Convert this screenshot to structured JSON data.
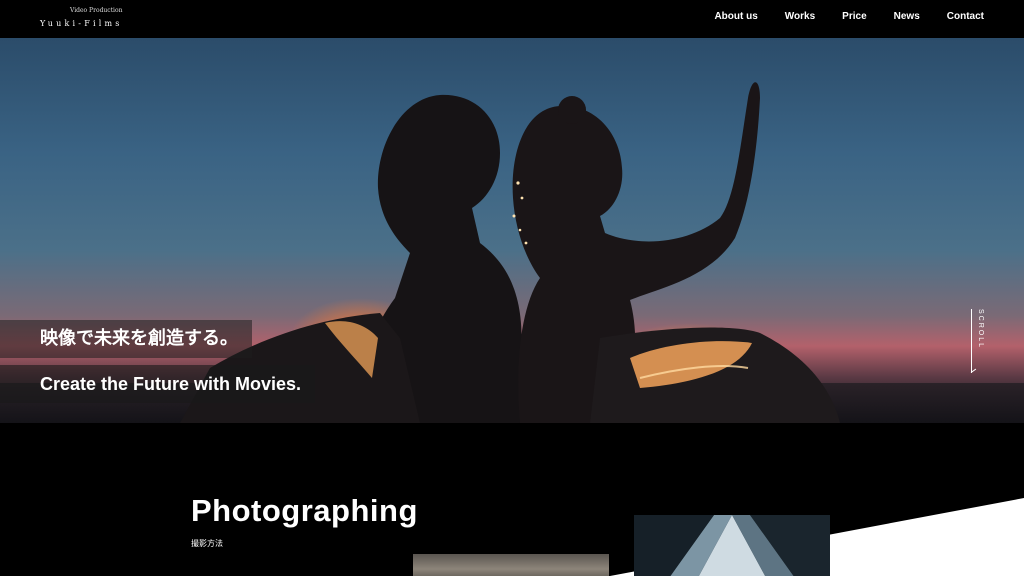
{
  "header": {
    "logo_sub": "Video Production",
    "logo_main": "Yuuki-Films",
    "nav": [
      "About us",
      "Works",
      "Price",
      "News",
      "Contact"
    ]
  },
  "hero": {
    "tagline_jp": "映像で未来を創造する。",
    "tagline_en": "Create the Future with Movies.",
    "scroll_label": "SCROLL"
  },
  "section": {
    "title": "Photographing",
    "subtitle": "撮影方法"
  },
  "colors": {
    "background": "#000000",
    "text": "#ffffff",
    "sky_top": "#2b4c6a",
    "sunset": "#b3616b"
  }
}
